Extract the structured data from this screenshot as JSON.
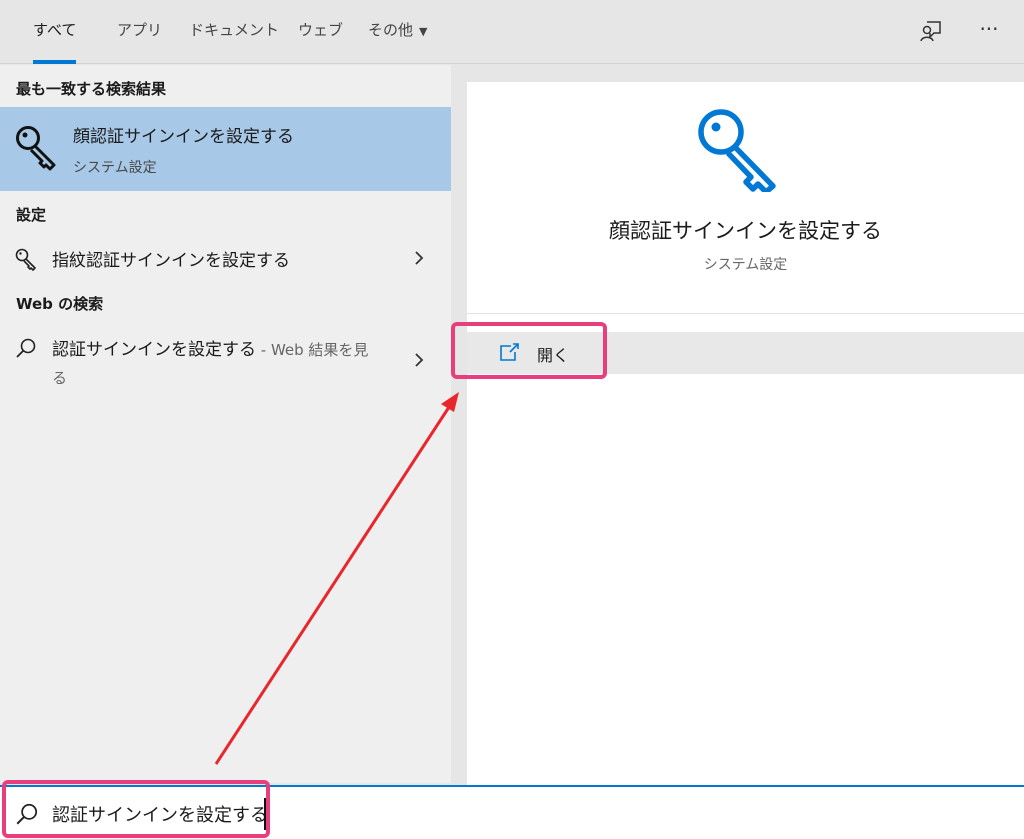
{
  "tabs": [
    {
      "label": "すべて",
      "active": true
    },
    {
      "label": "アプリ"
    },
    {
      "label": "ドキュメント"
    },
    {
      "label": "ウェブ"
    },
    {
      "label": "その他"
    }
  ],
  "top_icons": [
    "feedback-icon",
    "more-options-icon"
  ],
  "more_options_glyph": "···",
  "best_match": {
    "section": "最も一致する検索結果",
    "title": "顔認証サインインを設定する",
    "subtitle": "システム設定",
    "icon": "key-icon"
  },
  "settings": {
    "section": "設定",
    "items": [
      {
        "label": "指紋認証サインインを設定する",
        "icon": "key-icon"
      }
    ]
  },
  "web": {
    "section": "Web の検索",
    "item": {
      "query": "認証サインインを設定する",
      "suffix": " - Web 結果を見る",
      "icon": "search-icon"
    }
  },
  "preview": {
    "title": "顔認証サインインを設定する",
    "subtitle": "システム設定",
    "action_label": "開く",
    "action_icon": "open-external-icon",
    "icon_color": "#0078d4"
  },
  "search": {
    "value": "認証サインインを設定する",
    "icon": "search-icon"
  },
  "colors": {
    "accent": "#0078d4",
    "selection": "#a7c8e6",
    "highlight_box": "#e83e7c",
    "arrow": "#e8262b"
  }
}
